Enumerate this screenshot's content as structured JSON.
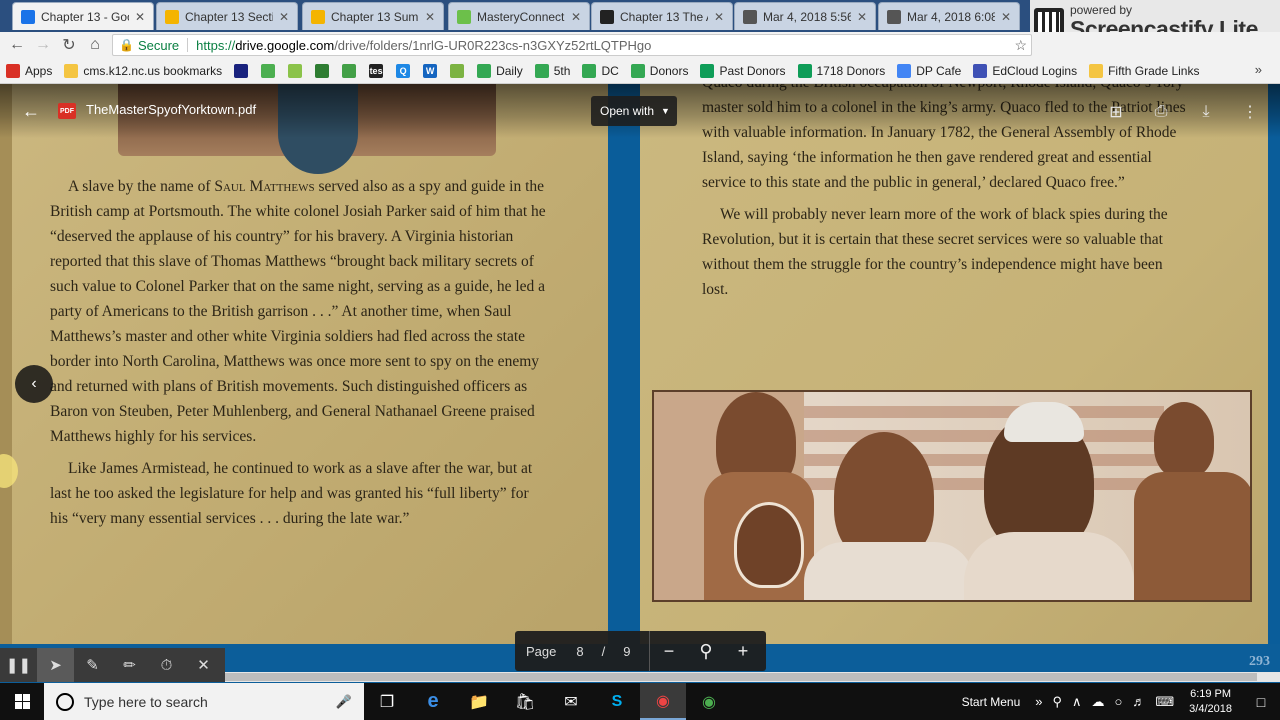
{
  "browser": {
    "tabs": [
      {
        "label": "Chapter 13 - Goo",
        "icon": "google-drive-icon",
        "color": "#1a73e8",
        "active": true
      },
      {
        "label": "Chapter 13 Sectio",
        "icon": "slides-icon",
        "color": "#f4b400"
      },
      {
        "label": "Chapter 13 Summ",
        "icon": "slides-icon",
        "color": "#f4b400"
      },
      {
        "label": "MasteryConnect",
        "icon": "masteryconnect-icon",
        "color": "#6cc04a"
      },
      {
        "label": "Chapter 13 The A",
        "icon": "tes-icon",
        "color": "#222222"
      },
      {
        "label": "Mar 4, 2018 5:56",
        "icon": "film-icon",
        "color": "#555555"
      },
      {
        "label": "Mar 4, 2018 6:08",
        "icon": "film-icon",
        "color": "#555555"
      }
    ],
    "secure_label": "Secure",
    "url_scheme": "https://",
    "url_host": "drive.google.com",
    "url_path": "/drive/folders/1nrlG-UR0R223cs-n3GXYz52rtLQTPHgo",
    "bookmarks": [
      {
        "label": "Apps",
        "color": "#d93025"
      },
      {
        "label": "cms.k12.nc.us bookmarks",
        "color": "#f4c542"
      },
      {
        "label": "",
        "color": "#1a237e",
        "icon": "nc-icon"
      },
      {
        "label": "",
        "color": "#4caf50",
        "icon": "bookmark-icon-2"
      },
      {
        "label": "",
        "color": "#8bc34a",
        "icon": "bookmark-icon-3"
      },
      {
        "label": "",
        "color": "#2e7d32",
        "icon": "bookmark-icon-4"
      },
      {
        "label": "",
        "color": "#43a047",
        "icon": "bookmark-icon-5"
      },
      {
        "label": "",
        "color": "#222222",
        "icon": "tes-bookmark-icon",
        "text": "tes"
      },
      {
        "label": "",
        "color": "#1e88e5",
        "icon": "quizlet-icon",
        "text": "Q"
      },
      {
        "label": "",
        "color": "#1565c0",
        "icon": "w-icon",
        "text": "W"
      },
      {
        "label": "",
        "color": "#7cb342",
        "icon": "bookmark-icon-9"
      },
      {
        "label": "Daily",
        "color": "#34a853"
      },
      {
        "label": "5th",
        "color": "#34a853"
      },
      {
        "label": "DC",
        "color": "#34a853"
      },
      {
        "label": "Donors",
        "color": "#34a853"
      },
      {
        "label": "Past Donors",
        "color": "#0f9d58"
      },
      {
        "label": "1718 Donors",
        "color": "#0f9d58"
      },
      {
        "label": "DP Cafe",
        "color": "#4285f4"
      },
      {
        "label": "EdCloud Logins",
        "color": "#3f51b5"
      },
      {
        "label": "Fifth Grade Links",
        "color": "#f4c542"
      }
    ]
  },
  "watermark": {
    "powered": "powered by",
    "brand": "Screencastify Lite"
  },
  "viewer": {
    "filename": "TheMasterSpyofYorktown.pdf",
    "open_with": "Open with",
    "page_label": "Page",
    "page_current": "8",
    "page_separator": "/",
    "page_total": "9",
    "book_page_number": "293"
  },
  "book": {
    "left_p1": [
      "A slave by the name of ",
      "Saul Matthews",
      " served also as a spy and guide in the British camp at Portsmouth. The white colonel Josiah Parker said of him that he “deserved the applause of his country” for his bravery. A Virginia historian reported that this slave of Thomas Matthews “brought back military secrets of such value to Colonel Parker that on the same night, serving as a guide, he led a party of Americans to the British garrison . . .” At another time, when Saul Matthews’s master and other white Virginia soldiers had fled across the state border into North Carolina, Matthews was once more sent to spy on the enemy and returned with plans of British movements. Such distinguished officers as Baron von Steuben, Peter Muhlenberg, and General Nathanael Greene praised Matthews highly for his services."
    ],
    "left_p2": "Like James Armistead, he continued to work as a slave after the war, but at last he too asked the legislature for help and was granted his “full liberty” for his “very many essential services . . . during the late war.”",
    "right_p0": "Quaco during the British occupation of Newport, Rhode Island, Quaco’s Tory master sold him to a colonel in the king’s army. Quaco fled to the Patriot lines with valuable information. In January 1782, the General Assembly of Rhode Island, saying ‘the information he then gave rendered great and essential service to this state and the public in general,’ declared Quaco free.”",
    "right_p1": "We will probably never learn more of the work of black spies during the Revolution, but it is certain that these secret services were so valuable that without them the struggle for the country’s independence might have been lost."
  },
  "taskbar": {
    "search_placeholder": "Type here to search",
    "start_menu": "Start Menu",
    "time": "6:19 PM",
    "date": "3/4/2018"
  }
}
